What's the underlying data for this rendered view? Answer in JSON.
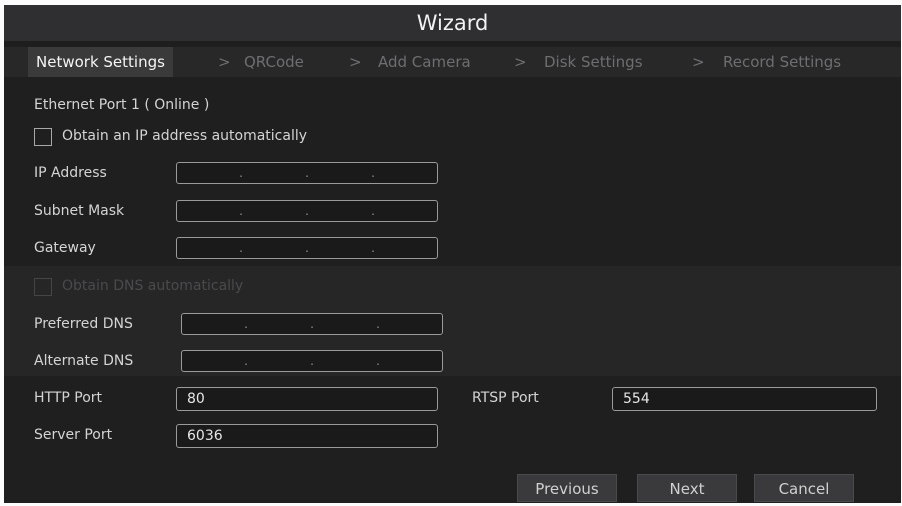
{
  "window": {
    "title": "Wizard"
  },
  "steps": [
    {
      "label": "Network Settings",
      "active": true
    },
    {
      "label": "QRCode",
      "active": false
    },
    {
      "label": "Add Camera",
      "active": false
    },
    {
      "label": "Disk Settings",
      "active": false
    },
    {
      "label": "Record Settings",
      "active": false
    }
  ],
  "step_separator": ">",
  "network": {
    "section_title": "Ethernet Port 1 ( Online )",
    "obtain_ip_auto": {
      "label": "Obtain an IP address automatically",
      "checked": false
    },
    "ip_address": {
      "label": "IP Address",
      "octets": [
        "",
        "",
        "",
        ""
      ]
    },
    "subnet_mask": {
      "label": "Subnet Mask",
      "octets": [
        "",
        "",
        "",
        ""
      ]
    },
    "gateway": {
      "label": "Gateway",
      "octets": [
        "",
        "",
        "",
        ""
      ]
    },
    "obtain_dns_auto": {
      "label": "Obtain DNS automatically",
      "checked": false,
      "disabled": true
    },
    "preferred_dns": {
      "label": "Preferred DNS",
      "octets": [
        "",
        "",
        "",
        ""
      ]
    },
    "alternate_dns": {
      "label": "Alternate DNS",
      "octets": [
        "",
        "",
        "",
        ""
      ]
    },
    "http_port": {
      "label": "HTTP Port",
      "value": "80"
    },
    "rtsp_port": {
      "label": "RTSP Port",
      "value": "554"
    },
    "server_port": {
      "label": "Server Port",
      "value": "6036"
    }
  },
  "footer": {
    "previous_label": "Previous",
    "next_label": "Next",
    "cancel_label": "Cancel"
  },
  "colors": {
    "background": "#1e1e1f",
    "title_bar": "#2f2f31",
    "active_step": "#3a3a3b",
    "inactive_step_text": "#6e6e70"
  }
}
